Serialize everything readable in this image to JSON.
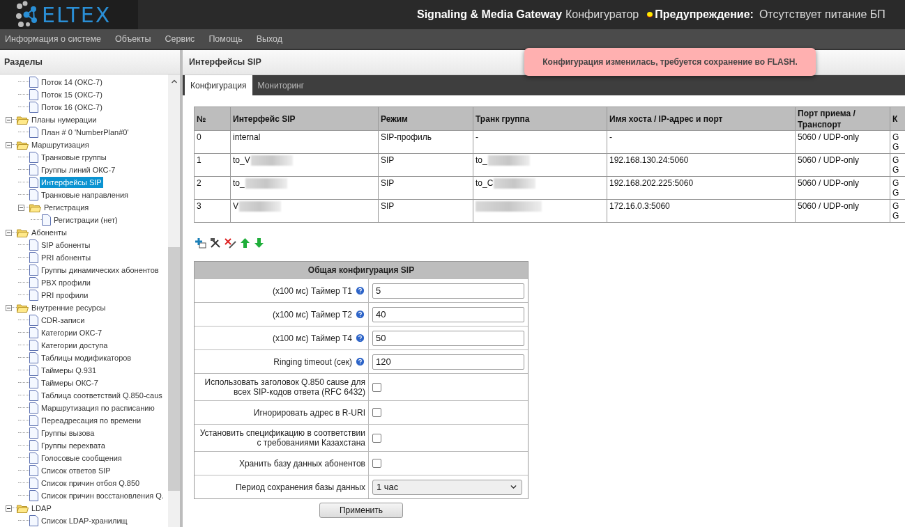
{
  "header": {
    "logo": "ELTEX",
    "product": "Signaling & Media Gateway",
    "app": "Конфигуратор",
    "warning_label": "Предупреждение:",
    "warning_text": "Отсутствует питание БП"
  },
  "menu": [
    "Информация о системе",
    "Объекты",
    "Сервис",
    "Помощь",
    "Выход"
  ],
  "sidebar": {
    "title": "Разделы",
    "tree": [
      {
        "children": [
          {
            "label": "Поток 14 (ОКС-7)",
            "selected": false
          },
          {
            "label": "Поток 15 (ОКС-7)",
            "selected": false
          },
          {
            "label": "Поток 16 (ОКС-7)",
            "selected": false
          }
        ]
      },
      {
        "label": "Планы нумерации",
        "expanded": true,
        "selected": false,
        "children": [
          {
            "label": "План # 0 'NumberPlan#0'",
            "selected": false
          }
        ]
      },
      {
        "label": "Маршрутизация",
        "expanded": true,
        "selected": false,
        "children": [
          {
            "label": "Транковые группы",
            "selected": false
          },
          {
            "label": "Группы линий ОКС-7",
            "selected": false
          },
          {
            "label": "Интерфейсы SIP",
            "selected": true
          },
          {
            "label": "Транковые направления",
            "selected": false
          },
          {
            "label": "Регистрация",
            "expanded": true,
            "selected": false,
            "children": [
              {
                "label": "Регистрации (нет)",
                "selected": false
              }
            ]
          }
        ]
      },
      {
        "label": "Абоненты",
        "expanded": true,
        "selected": false,
        "children": [
          {
            "label": "SIP абоненты",
            "selected": false
          },
          {
            "label": "PRI абоненты",
            "selected": false
          },
          {
            "label": "Группы динамических абонентов",
            "selected": false
          },
          {
            "label": "PBX профили",
            "selected": false
          },
          {
            "label": "PRI профили",
            "selected": false
          }
        ]
      },
      {
        "label": "Внутренние ресурсы",
        "expanded": true,
        "selected": false,
        "children": [
          {
            "label": "CDR-записи",
            "selected": false
          },
          {
            "label": "Категории ОКС-7",
            "selected": false
          },
          {
            "label": "Категории доступа",
            "selected": false
          },
          {
            "label": "Таблицы модификаторов",
            "selected": false
          },
          {
            "label": "Таймеры Q.931",
            "selected": false
          },
          {
            "label": "Таймеры ОКС-7",
            "selected": false
          },
          {
            "label": "Таблица соответствий Q.850-caus",
            "selected": false
          },
          {
            "label": "Маршрутизация по расписанию",
            "selected": false
          },
          {
            "label": "Переадресация по времени",
            "selected": false
          },
          {
            "label": "Группы вызова",
            "selected": false
          },
          {
            "label": "Группы перехвата",
            "selected": false
          },
          {
            "label": "Голосовые сообщения",
            "selected": false
          },
          {
            "label": "Список ответов SIP",
            "selected": false
          },
          {
            "label": "Список причин отбоя Q.850",
            "selected": false
          },
          {
            "label": "Список причин восстановления Q.",
            "selected": false
          }
        ]
      },
      {
        "label": "LDAP",
        "expanded": true,
        "selected": false,
        "children": [
          {
            "label": "Список LDAP-хранилищ",
            "selected": false
          }
        ]
      }
    ]
  },
  "main": {
    "title": "Интерфейсы SIP",
    "toast": "Конфигурация изменилась, требуется сохранение во FLASH.",
    "tabs": [
      {
        "label": "Конфигурация",
        "selected": true
      },
      {
        "label": "Мониторинг",
        "selected": false
      }
    ],
    "table": {
      "columns": [
        "№",
        "Интерфейс SIP",
        "Режим",
        "Транк группа",
        "Имя хоста / IP-адрес и порт",
        "Порт приема / Транспорт",
        "К"
      ],
      "rows": [
        {
          "cells": [
            "0",
            "internal",
            "SIP-профиль",
            "-",
            "-",
            "5060 / UDP-only",
            "G G"
          ]
        },
        {
          "cells": [
            "1",
            {
              "text": "to_V",
              "blurred": true
            },
            "SIP",
            {
              "text": "to_",
              "blurred": true
            },
            "192.168.130.24:5060",
            "5060 / UDP-only",
            "G G"
          ]
        },
        {
          "cells": [
            "2",
            {
              "text": "to_",
              "blurred": true
            },
            "SIP",
            {
              "text": "to_C",
              "blurred": true
            },
            "192.168.202.225:5060",
            "5060 / UDP-only",
            "G G"
          ]
        },
        {
          "cells": [
            "3",
            {
              "text": "V",
              "blurred": true
            },
            "SIP",
            {
              "text": "",
              "blurred": true
            },
            "172.16.0.3:5060",
            "5060 / UDP-only",
            "G G"
          ]
        }
      ]
    },
    "config": {
      "title": "Общая конфигурация SIP",
      "rows": [
        {
          "kind": "text",
          "label": "(x100 мс) Таймер T1",
          "help": true,
          "value": "5"
        },
        {
          "kind": "text",
          "label": "(x100 мс) Таймер T2",
          "help": true,
          "value": "40"
        },
        {
          "kind": "text",
          "label": "(x100 мс) Таймер T4",
          "help": true,
          "value": "50"
        },
        {
          "kind": "text",
          "label": "Ringing timeout (сек)",
          "help": true,
          "value": "120"
        },
        {
          "kind": "checkbox",
          "label": "Использовать заголовок Q.850 cause для всех SIP-кодов ответа (RFC 6432)",
          "checked": false
        },
        {
          "kind": "checkbox",
          "label": "Игнорировать адрес в R-URI",
          "checked": false
        },
        {
          "kind": "checkbox",
          "label": "Установить спецификацию в соответствии с требованиями Казахстана",
          "checked": false
        },
        {
          "kind": "checkbox",
          "label": "Хранить базу данных абонентов",
          "checked": false
        },
        {
          "kind": "select",
          "label": "Период сохранения базы данных",
          "value": "1 час"
        }
      ]
    },
    "apply": "Применить"
  }
}
